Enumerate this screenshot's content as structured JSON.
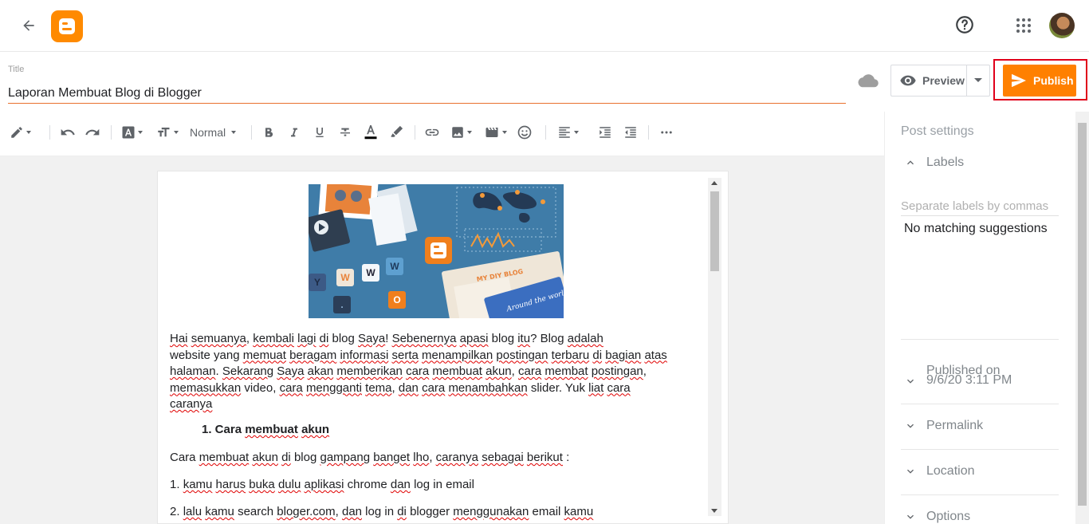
{
  "header": {
    "back_icon": "arrow-left-icon",
    "logo": "blogger-logo",
    "help_icon": "help-circle-icon",
    "apps_icon": "apps-grid-icon"
  },
  "title_field": {
    "label": "Title",
    "value": "Laporan Membuat Blog di Blogger"
  },
  "actions": {
    "preview_label": "Preview",
    "publish_label": "Publish"
  },
  "toolbar": {
    "format_select": "Normal"
  },
  "content": {
    "paragraph1": [
      {
        "t": "Hai",
        "u": true
      },
      {
        "t": " "
      },
      {
        "t": "semuanya",
        "u": true
      },
      {
        "t": ", "
      },
      {
        "t": "kembali",
        "u": true
      },
      {
        "t": " "
      },
      {
        "t": "lagi",
        "u": true
      },
      {
        "t": " "
      },
      {
        "t": "di",
        "u": true
      },
      {
        "t": " blog "
      },
      {
        "t": "Saya",
        "u": true
      },
      {
        "t": "! "
      },
      {
        "t": "Sebenernya",
        "u": true
      },
      {
        "t": " "
      },
      {
        "t": "apasi",
        "u": true
      },
      {
        "t": " blog "
      },
      {
        "t": "itu",
        "u": true
      },
      {
        "t": "? Blog "
      },
      {
        "t": "adalah",
        "u": true
      },
      {
        "t": "\nwebsite yang "
      },
      {
        "t": "memuat",
        "u": true
      },
      {
        "t": " "
      },
      {
        "t": "beragam",
        "u": true
      },
      {
        "t": " "
      },
      {
        "t": "informasi",
        "u": true
      },
      {
        "t": " "
      },
      {
        "t": "serta",
        "u": true
      },
      {
        "t": " "
      },
      {
        "t": "menampilkan",
        "u": true
      },
      {
        "t": " "
      },
      {
        "t": "postingan",
        "u": true
      },
      {
        "t": " "
      },
      {
        "t": "terbaru",
        "u": true
      },
      {
        "t": " "
      },
      {
        "t": "di",
        "u": true
      },
      {
        "t": " "
      },
      {
        "t": "bagian",
        "u": true
      },
      {
        "t": " "
      },
      {
        "t": "atas",
        "u": true
      },
      {
        "t": "\n"
      },
      {
        "t": "halaman",
        "u": true
      },
      {
        "t": ". "
      },
      {
        "t": "Sekarang",
        "u": true
      },
      {
        "t": " "
      },
      {
        "t": "Saya",
        "u": true
      },
      {
        "t": " "
      },
      {
        "t": "akan",
        "u": true
      },
      {
        "t": " "
      },
      {
        "t": "memberikan",
        "u": true
      },
      {
        "t": " "
      },
      {
        "t": "cara",
        "u": true
      },
      {
        "t": " "
      },
      {
        "t": "membuat",
        "u": true
      },
      {
        "t": " "
      },
      {
        "t": "akun",
        "u": true
      },
      {
        "t": ", "
      },
      {
        "t": "cara",
        "u": true
      },
      {
        "t": " "
      },
      {
        "t": "membat",
        "u": true
      },
      {
        "t": " "
      },
      {
        "t": "postingan",
        "u": true
      },
      {
        "t": ",\n"
      },
      {
        "t": "memasukkan",
        "u": true
      },
      {
        "t": " video, "
      },
      {
        "t": "cara",
        "u": true
      },
      {
        "t": " "
      },
      {
        "t": "mengganti",
        "u": true
      },
      {
        "t": " "
      },
      {
        "t": "tema",
        "u": true
      },
      {
        "t": ", "
      },
      {
        "t": "dan",
        "u": true
      },
      {
        "t": " "
      },
      {
        "t": "cara",
        "u": true
      },
      {
        "t": " "
      },
      {
        "t": "menambahkan",
        "u": true
      },
      {
        "t": " slider. Yuk "
      },
      {
        "t": "liat",
        "u": true
      },
      {
        "t": " "
      },
      {
        "t": "cara",
        "u": true
      },
      {
        "t": "\n"
      },
      {
        "t": "caranya",
        "u": true
      }
    ],
    "heading1": [
      {
        "t": "1. Cara "
      },
      {
        "t": "membuat",
        "u": true
      },
      {
        "t": " "
      },
      {
        "t": "akun",
        "u": true
      }
    ],
    "paragraph2": [
      {
        "t": "Cara "
      },
      {
        "t": "membuat",
        "u": true
      },
      {
        "t": " "
      },
      {
        "t": "akun",
        "u": true
      },
      {
        "t": " "
      },
      {
        "t": "di",
        "u": true
      },
      {
        "t": " blog "
      },
      {
        "t": "gampang",
        "u": true
      },
      {
        "t": " "
      },
      {
        "t": "banget",
        "u": true
      },
      {
        "t": " "
      },
      {
        "t": "lho",
        "u": true
      },
      {
        "t": ", "
      },
      {
        "t": "caranya",
        "u": true
      },
      {
        "t": " "
      },
      {
        "t": "sebagai",
        "u": true
      },
      {
        "t": " "
      },
      {
        "t": "berikut",
        "u": true
      },
      {
        "t": " :"
      }
    ],
    "step1": [
      {
        "t": "1. "
      },
      {
        "t": "kamu",
        "u": true
      },
      {
        "t": " "
      },
      {
        "t": "harus",
        "u": true
      },
      {
        "t": " "
      },
      {
        "t": "buka",
        "u": true
      },
      {
        "t": " "
      },
      {
        "t": "dulu",
        "u": true
      },
      {
        "t": " "
      },
      {
        "t": "aplikasi",
        "u": true
      },
      {
        "t": " chrome "
      },
      {
        "t": "dan",
        "u": true
      },
      {
        "t": " log in email"
      }
    ],
    "step2": [
      {
        "t": "2. "
      },
      {
        "t": "lalu",
        "u": true
      },
      {
        "t": " "
      },
      {
        "t": "kamu",
        "u": true
      },
      {
        "t": " search "
      },
      {
        "t": "bloger.com",
        "u": true
      },
      {
        "t": ", "
      },
      {
        "t": "dan",
        "u": true
      },
      {
        "t": " log in "
      },
      {
        "t": "di",
        "u": true
      },
      {
        "t": " blogger "
      },
      {
        "t": "menggunakan",
        "u": true
      },
      {
        "t": " email "
      },
      {
        "t": "kamu",
        "u": true
      }
    ],
    "hero_image": {
      "tiles": [
        "Y",
        "W",
        "W",
        "W",
        "O"
      ],
      "blog_banner": "MY DIY BLOG",
      "blog_card": "Around the world"
    }
  },
  "settings": {
    "title": "Post settings",
    "labels_header": "Labels",
    "labels_placeholder": "Separate labels by commas",
    "labels_value": "",
    "no_match": "No matching suggestions",
    "published_header": "Published on",
    "published_value": "9/6/20 3:11 PM",
    "permalink_header": "Permalink",
    "location_header": "Location",
    "options_header": "Options"
  },
  "colors": {
    "accent": "#ff8000",
    "highlight_frame": "#e0001a",
    "title_underline": "#e8712e",
    "spell_underline": "#e00000"
  }
}
